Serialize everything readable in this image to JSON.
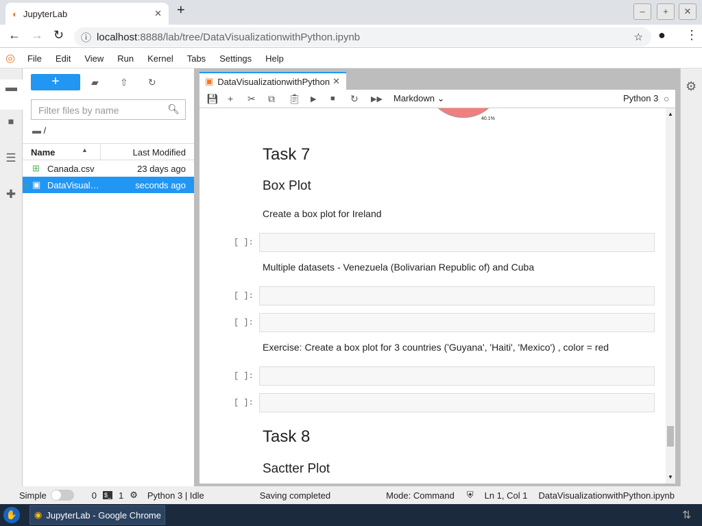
{
  "browser": {
    "tab_title": "JupyterLab",
    "url_host": "localhost",
    "url_path": ":8888/lab/tree/DataVisualizationwithPython.ipynb"
  },
  "menu": [
    "File",
    "Edit",
    "View",
    "Run",
    "Kernel",
    "Tabs",
    "Settings",
    "Help"
  ],
  "filebrowser": {
    "filter_placeholder": "Filter files by name",
    "path": "/",
    "col_name": "Name",
    "col_modified": "Last Modified",
    "files": [
      {
        "name": "Canada.csv",
        "modified": "23 days ago"
      },
      {
        "name": "DataVisual…",
        "modified": "seconds ago"
      }
    ]
  },
  "notebook": {
    "tab": "DataVisualizationwithPython",
    "cell_type": "Markdown",
    "kernel": "Python 3",
    "pie_label": "40.1%",
    "cells": {
      "h_task7": "Task 7",
      "h_box": "Box Plot",
      "p1": "Create a box plot for Ireland",
      "p2": "Multiple datasets - Venezuela (Bolivarian Republic of) and Cuba",
      "p3": "Exercise: Create a box plot for 3 countries ('Guyana', 'Haiti', 'Mexico') , color = red",
      "h_task8": "Task 8",
      "h_scatter": "Sactter Plot",
      "prompt": "[ ]:"
    }
  },
  "status": {
    "mode_label": "Simple",
    "terminals": "0",
    "kernels": "1",
    "kernel_state": "Python 3 | Idle",
    "saving": "Saving completed",
    "mode": "Mode: Command",
    "position": "Ln 1, Col 1",
    "file": "DataVisualizationwithPython.ipynb"
  },
  "taskbar": {
    "app": "JupyterLab - Google Chrome"
  }
}
